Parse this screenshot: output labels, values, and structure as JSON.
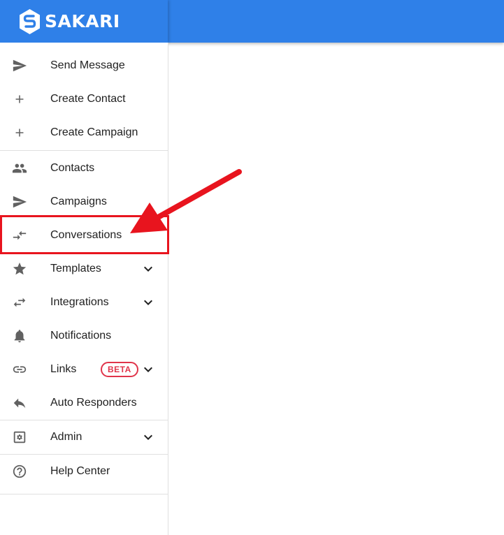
{
  "app": {
    "brand": "SAKARI",
    "brand_color": "#2f80e8"
  },
  "sidebar": {
    "quick_actions": [
      {
        "label": "Send Message",
        "icon": "send-icon"
      },
      {
        "label": "Create Contact",
        "icon": "plus-icon"
      },
      {
        "label": "Create Campaign",
        "icon": "plus-icon"
      }
    ],
    "nav": [
      {
        "label": "Contacts",
        "icon": "people-icon"
      },
      {
        "label": "Campaigns",
        "icon": "send-icon"
      },
      {
        "label": "Conversations",
        "icon": "compare-arrows-icon",
        "highlighted": true
      },
      {
        "label": "Templates",
        "icon": "star-icon",
        "expandable": true
      },
      {
        "label": "Integrations",
        "icon": "swap-horiz-icon",
        "expandable": true
      },
      {
        "label": "Notifications",
        "icon": "bell-icon"
      },
      {
        "label": "Links",
        "icon": "link-icon",
        "expandable": true,
        "badge": "BETA"
      },
      {
        "label": "Auto Responders",
        "icon": "reply-icon"
      }
    ],
    "admin": {
      "label": "Admin",
      "icon": "settings-box-icon",
      "expandable": true
    },
    "help": {
      "label": "Help Center",
      "icon": "help-circle-icon"
    }
  },
  "annotation": {
    "color": "#e8141e"
  }
}
